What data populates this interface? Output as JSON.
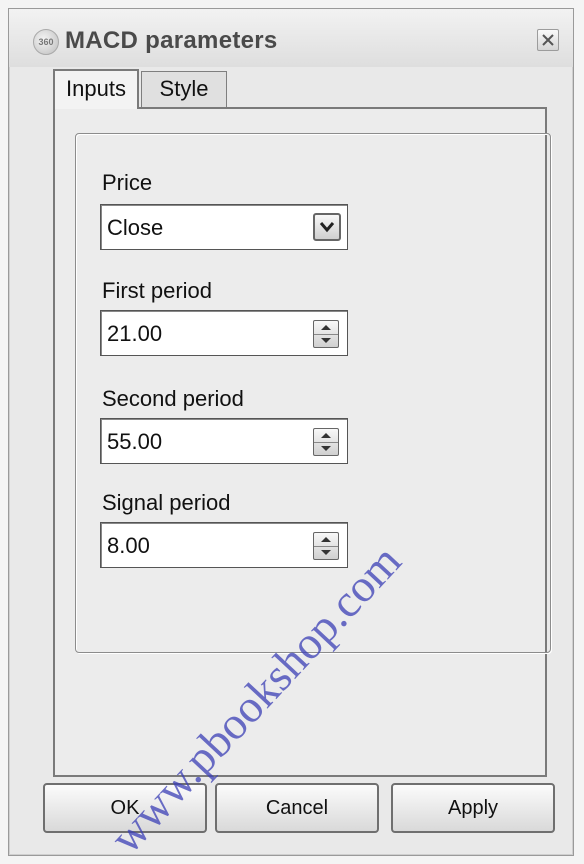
{
  "dialog": {
    "title": "MACD parameters",
    "app_icon_text": "360",
    "close_icon": "close-icon"
  },
  "tabs": [
    {
      "label": "Inputs",
      "active": true
    },
    {
      "label": "Style",
      "active": false
    }
  ],
  "fields": {
    "price": {
      "label": "Price",
      "value": "Close",
      "control": "dropdown"
    },
    "first_period": {
      "label": "First period",
      "value": "21.00",
      "control": "spinner"
    },
    "second_period": {
      "label": "Second period",
      "value": "55.00",
      "control": "spinner"
    },
    "signal_period": {
      "label": "Signal period",
      "value": "8.00",
      "control": "spinner"
    }
  },
  "buttons": {
    "ok": "OK",
    "cancel": "Cancel",
    "apply": "Apply"
  },
  "watermark": {
    "text": "www.pbookshop.com",
    "color": "#3b3fb5"
  }
}
